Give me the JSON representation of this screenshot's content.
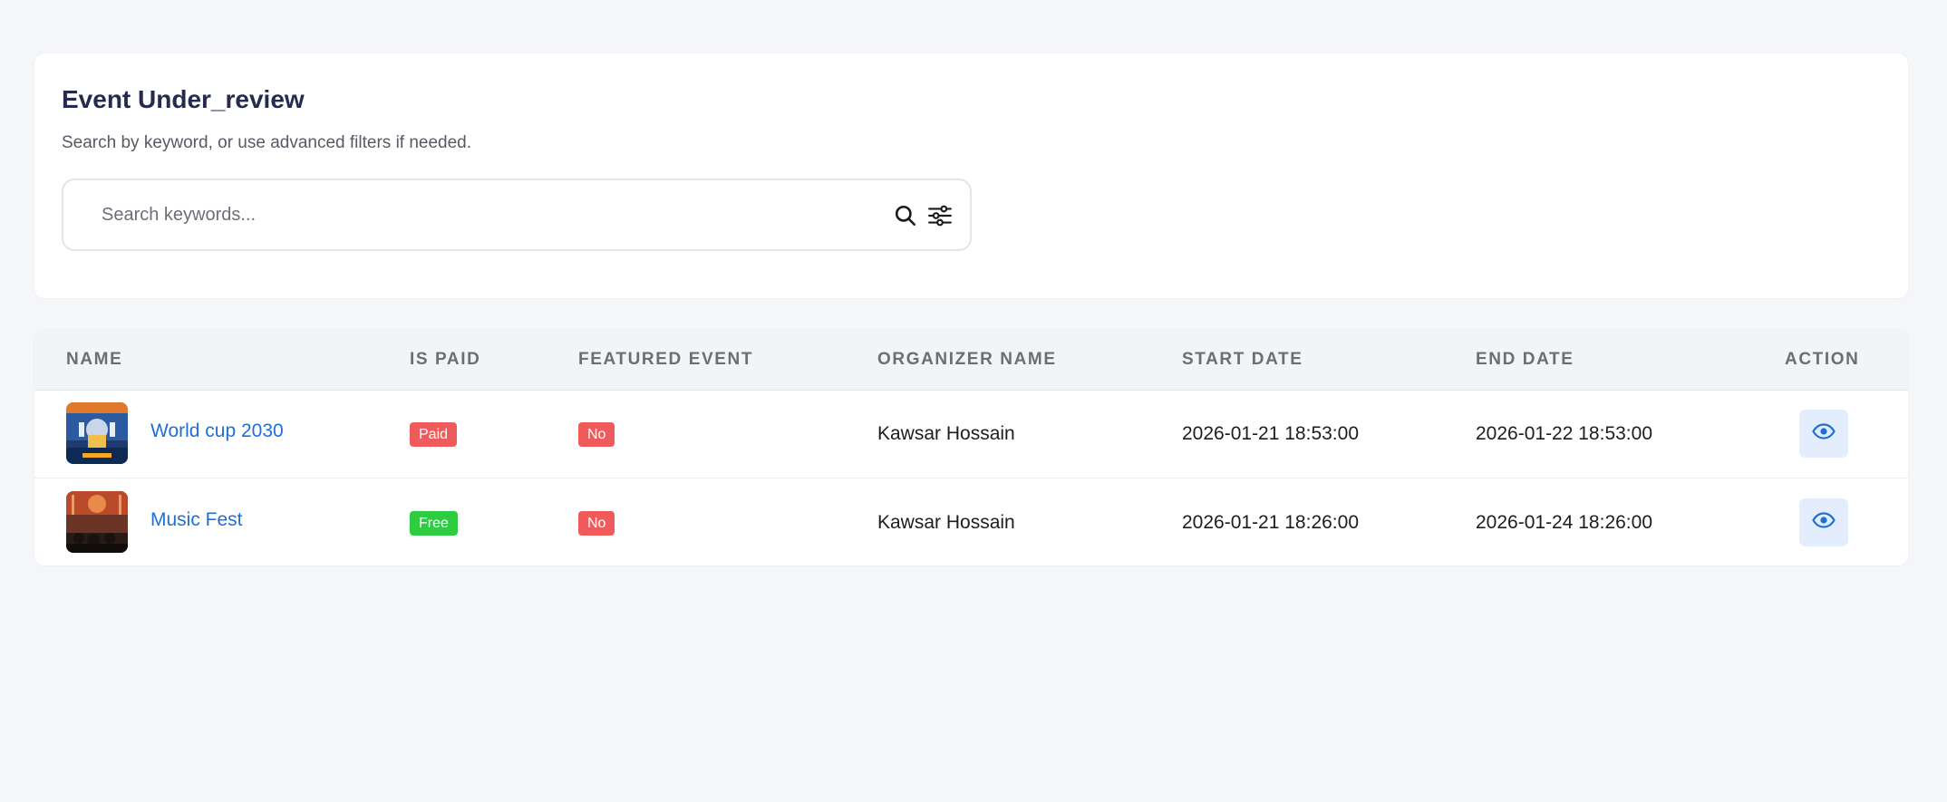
{
  "header": {
    "title": "Event Under_review",
    "subtitle": "Search by keyword, or use advanced filters if needed."
  },
  "search": {
    "placeholder": "Search keywords...",
    "value": "",
    "icons": [
      "search-icon",
      "filter-sliders-icon"
    ]
  },
  "table": {
    "columns": [
      "NAME",
      "IS PAID",
      "FEATURED EVENT",
      "ORGANIZER NAME",
      "START DATE",
      "END DATE",
      "ACTION"
    ],
    "rows": [
      {
        "name": "World cup 2030",
        "is_paid": "Paid",
        "featured": "No",
        "organizer": "Kawsar Hossain",
        "start_date": "2026-01-21 18:53:00",
        "end_date": "2026-01-22 18:53:00",
        "action_icon": "eye-icon"
      },
      {
        "name": "Music Fest",
        "is_paid": "Free",
        "featured": "No",
        "organizer": "Kawsar Hossain",
        "start_date": "2026-01-21 18:26:00",
        "end_date": "2026-01-24 18:26:00",
        "action_icon": "eye-icon"
      }
    ]
  },
  "colors": {
    "paid": "#ef5b5b",
    "free": "#2ecc40",
    "no": "#ef5b5b",
    "link": "#1f6fd6",
    "title": "#262a4f"
  }
}
